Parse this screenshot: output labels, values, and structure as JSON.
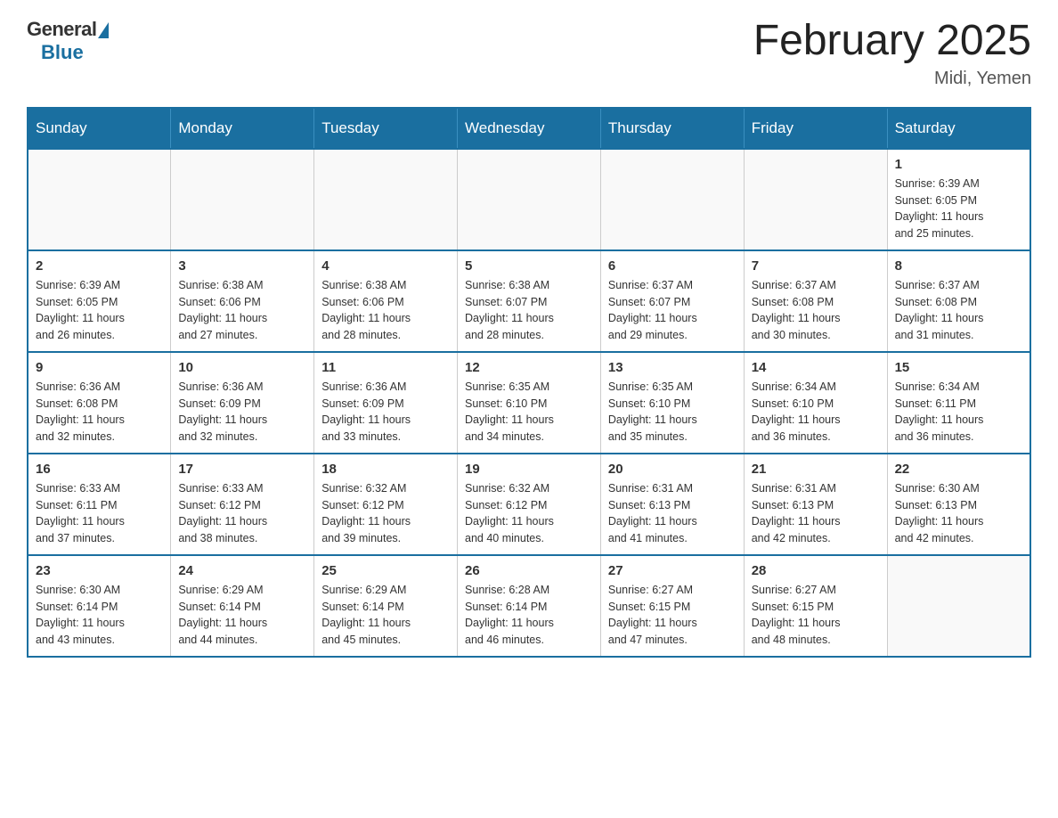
{
  "header": {
    "logo_general": "General",
    "logo_blue": "Blue",
    "month_title": "February 2025",
    "location": "Midi, Yemen"
  },
  "weekdays": [
    "Sunday",
    "Monday",
    "Tuesday",
    "Wednesday",
    "Thursday",
    "Friday",
    "Saturday"
  ],
  "weeks": [
    [
      {
        "day": "",
        "info": ""
      },
      {
        "day": "",
        "info": ""
      },
      {
        "day": "",
        "info": ""
      },
      {
        "day": "",
        "info": ""
      },
      {
        "day": "",
        "info": ""
      },
      {
        "day": "",
        "info": ""
      },
      {
        "day": "1",
        "info": "Sunrise: 6:39 AM\nSunset: 6:05 PM\nDaylight: 11 hours\nand 25 minutes."
      }
    ],
    [
      {
        "day": "2",
        "info": "Sunrise: 6:39 AM\nSunset: 6:05 PM\nDaylight: 11 hours\nand 26 minutes."
      },
      {
        "day": "3",
        "info": "Sunrise: 6:38 AM\nSunset: 6:06 PM\nDaylight: 11 hours\nand 27 minutes."
      },
      {
        "day": "4",
        "info": "Sunrise: 6:38 AM\nSunset: 6:06 PM\nDaylight: 11 hours\nand 28 minutes."
      },
      {
        "day": "5",
        "info": "Sunrise: 6:38 AM\nSunset: 6:07 PM\nDaylight: 11 hours\nand 28 minutes."
      },
      {
        "day": "6",
        "info": "Sunrise: 6:37 AM\nSunset: 6:07 PM\nDaylight: 11 hours\nand 29 minutes."
      },
      {
        "day": "7",
        "info": "Sunrise: 6:37 AM\nSunset: 6:08 PM\nDaylight: 11 hours\nand 30 minutes."
      },
      {
        "day": "8",
        "info": "Sunrise: 6:37 AM\nSunset: 6:08 PM\nDaylight: 11 hours\nand 31 minutes."
      }
    ],
    [
      {
        "day": "9",
        "info": "Sunrise: 6:36 AM\nSunset: 6:08 PM\nDaylight: 11 hours\nand 32 minutes."
      },
      {
        "day": "10",
        "info": "Sunrise: 6:36 AM\nSunset: 6:09 PM\nDaylight: 11 hours\nand 32 minutes."
      },
      {
        "day": "11",
        "info": "Sunrise: 6:36 AM\nSunset: 6:09 PM\nDaylight: 11 hours\nand 33 minutes."
      },
      {
        "day": "12",
        "info": "Sunrise: 6:35 AM\nSunset: 6:10 PM\nDaylight: 11 hours\nand 34 minutes."
      },
      {
        "day": "13",
        "info": "Sunrise: 6:35 AM\nSunset: 6:10 PM\nDaylight: 11 hours\nand 35 minutes."
      },
      {
        "day": "14",
        "info": "Sunrise: 6:34 AM\nSunset: 6:10 PM\nDaylight: 11 hours\nand 36 minutes."
      },
      {
        "day": "15",
        "info": "Sunrise: 6:34 AM\nSunset: 6:11 PM\nDaylight: 11 hours\nand 36 minutes."
      }
    ],
    [
      {
        "day": "16",
        "info": "Sunrise: 6:33 AM\nSunset: 6:11 PM\nDaylight: 11 hours\nand 37 minutes."
      },
      {
        "day": "17",
        "info": "Sunrise: 6:33 AM\nSunset: 6:12 PM\nDaylight: 11 hours\nand 38 minutes."
      },
      {
        "day": "18",
        "info": "Sunrise: 6:32 AM\nSunset: 6:12 PM\nDaylight: 11 hours\nand 39 minutes."
      },
      {
        "day": "19",
        "info": "Sunrise: 6:32 AM\nSunset: 6:12 PM\nDaylight: 11 hours\nand 40 minutes."
      },
      {
        "day": "20",
        "info": "Sunrise: 6:31 AM\nSunset: 6:13 PM\nDaylight: 11 hours\nand 41 minutes."
      },
      {
        "day": "21",
        "info": "Sunrise: 6:31 AM\nSunset: 6:13 PM\nDaylight: 11 hours\nand 42 minutes."
      },
      {
        "day": "22",
        "info": "Sunrise: 6:30 AM\nSunset: 6:13 PM\nDaylight: 11 hours\nand 42 minutes."
      }
    ],
    [
      {
        "day": "23",
        "info": "Sunrise: 6:30 AM\nSunset: 6:14 PM\nDaylight: 11 hours\nand 43 minutes."
      },
      {
        "day": "24",
        "info": "Sunrise: 6:29 AM\nSunset: 6:14 PM\nDaylight: 11 hours\nand 44 minutes."
      },
      {
        "day": "25",
        "info": "Sunrise: 6:29 AM\nSunset: 6:14 PM\nDaylight: 11 hours\nand 45 minutes."
      },
      {
        "day": "26",
        "info": "Sunrise: 6:28 AM\nSunset: 6:14 PM\nDaylight: 11 hours\nand 46 minutes."
      },
      {
        "day": "27",
        "info": "Sunrise: 6:27 AM\nSunset: 6:15 PM\nDaylight: 11 hours\nand 47 minutes."
      },
      {
        "day": "28",
        "info": "Sunrise: 6:27 AM\nSunset: 6:15 PM\nDaylight: 11 hours\nand 48 minutes."
      },
      {
        "day": "",
        "info": ""
      }
    ]
  ]
}
